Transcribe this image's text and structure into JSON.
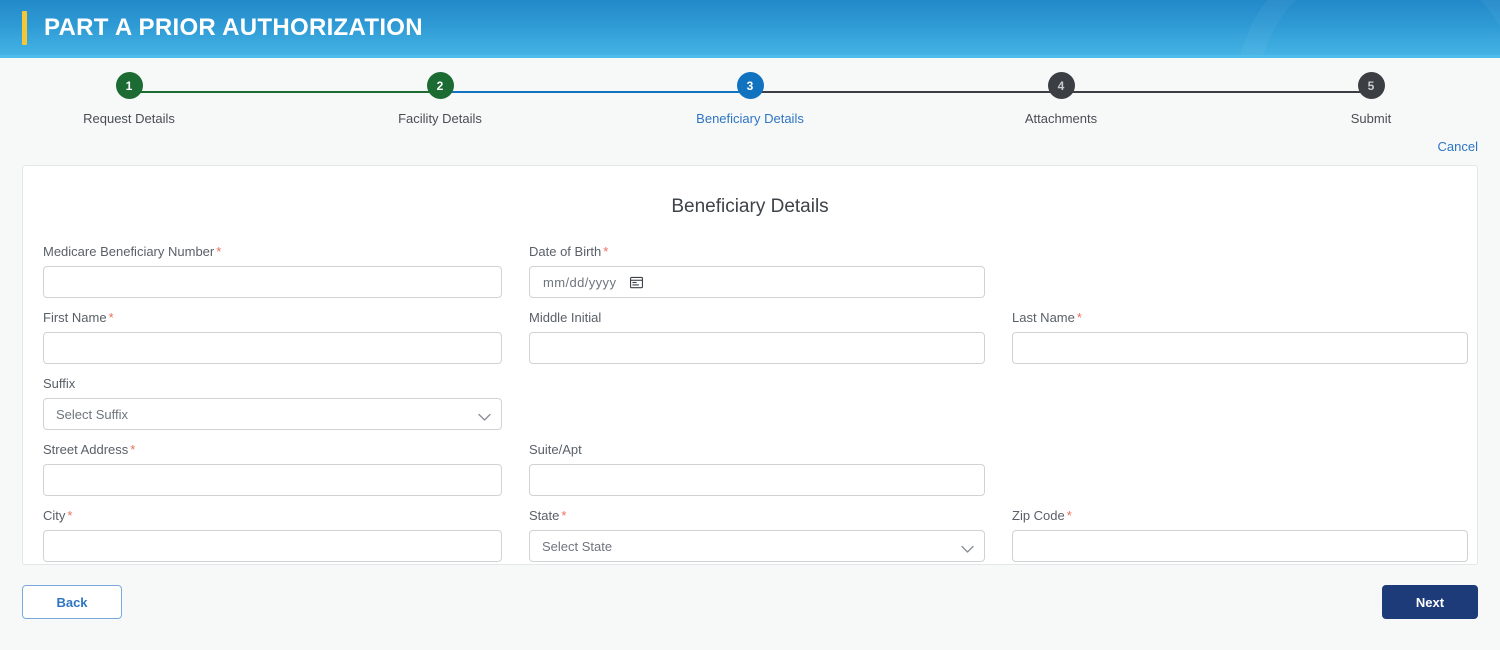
{
  "header": {
    "title": "PART A PRIOR AUTHORIZATION",
    "accent_color": "#f5c636",
    "gradient_top": "#2389c9",
    "gradient_bottom": "#44b2e4"
  },
  "stepper": {
    "steps": [
      {
        "number": "1",
        "label": "Request Details",
        "state": "complete"
      },
      {
        "number": "2",
        "label": "Facility Details",
        "state": "complete"
      },
      {
        "number": "3",
        "label": "Beneficiary Details",
        "state": "active"
      },
      {
        "number": "4",
        "label": "Attachments",
        "state": "upcoming"
      },
      {
        "number": "5",
        "label": "Submit",
        "state": "upcoming"
      }
    ],
    "colors": {
      "complete": "#1c6b33",
      "active": "#1173bf",
      "upcoming": "#3b3f44",
      "line_complete": "#1c6b33",
      "line_active": "#1173bf",
      "line_upcoming": "#3b3f44"
    }
  },
  "cancel": {
    "label": "Cancel"
  },
  "form": {
    "title": "Beneficiary Details",
    "fields": {
      "mbn": {
        "label": "Medicare Beneficiary Number",
        "required": true,
        "value": "",
        "placeholder": ""
      },
      "dob": {
        "label": "Date of Birth",
        "required": true,
        "value": "",
        "placeholder": "mm/dd/yyyy",
        "icon": "calendar-icon"
      },
      "first_name": {
        "label": "First Name",
        "required": true,
        "value": "",
        "placeholder": ""
      },
      "middle_initial": {
        "label": "Middle Initial",
        "required": false,
        "value": "",
        "placeholder": ""
      },
      "last_name": {
        "label": "Last Name",
        "required": true,
        "value": "",
        "placeholder": ""
      },
      "suffix": {
        "label": "Suffix",
        "required": false,
        "selected": "Select Suffix"
      },
      "street_address": {
        "label": "Street Address",
        "required": true,
        "value": "",
        "placeholder": ""
      },
      "suite_apt": {
        "label": "Suite/Apt",
        "required": false,
        "value": "",
        "placeholder": ""
      },
      "city": {
        "label": "City",
        "required": true,
        "value": "",
        "placeholder": ""
      },
      "state": {
        "label": "State",
        "required": true,
        "selected": "Select State"
      },
      "zip_code": {
        "label": "Zip Code",
        "required": true,
        "value": "",
        "placeholder": ""
      }
    },
    "required_marker": "*"
  },
  "footer": {
    "back_label": "Back",
    "next_label": "Next",
    "back_color": "#2e75c4",
    "next_color": "#1d3b79"
  }
}
